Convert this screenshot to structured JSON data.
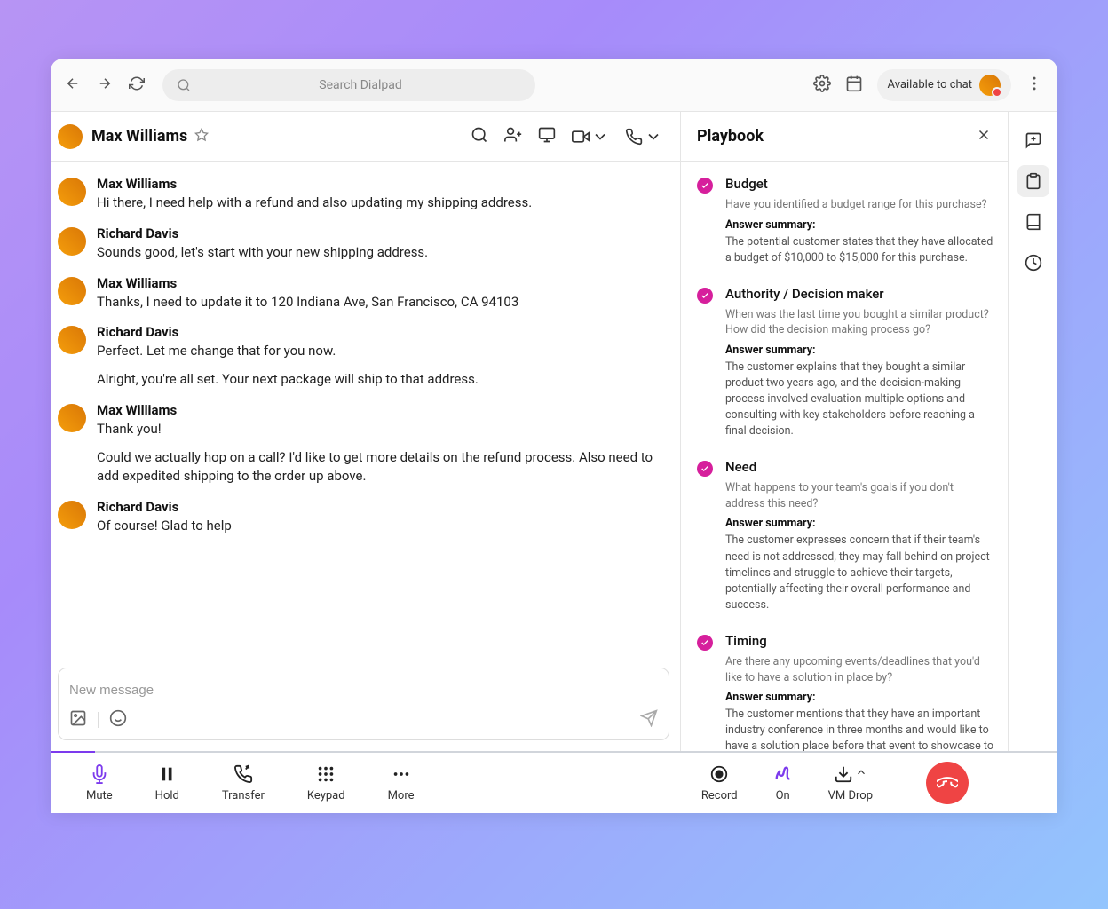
{
  "topbar": {
    "search_placeholder": "Search Dialpad",
    "status_text": "Available to chat"
  },
  "chat": {
    "contact_name": "Max Williams",
    "composer_placeholder": "New message",
    "messages": [
      {
        "name": "Max Williams",
        "texts": [
          "Hi there, I need help with a refund and also updating my shipping address."
        ]
      },
      {
        "name": "Richard Davis",
        "texts": [
          "Sounds good, let's start with your new shipping address."
        ]
      },
      {
        "name": "Max Williams",
        "texts": [
          "Thanks, I need to update it to 120 Indiana Ave, San Francisco, CA 94103"
        ]
      },
      {
        "name": "Richard Davis",
        "texts": [
          "Perfect. Let me change that for you now.",
          "Alright, you're all set. Your next package will ship to that address."
        ]
      },
      {
        "name": "Max Williams",
        "texts": [
          "Thank you!",
          "Could we actually hop on a call? I'd like to get more details on the refund process. Also need to add expedited shipping to the order up above."
        ]
      },
      {
        "name": "Richard Davis",
        "texts": [
          "Of course! Glad to help"
        ]
      }
    ]
  },
  "playbook": {
    "title": "Playbook",
    "answer_summary_label": "Answer summary:",
    "items": [
      {
        "title": "Budget",
        "question": "Have you identified a budget range for this purchase?",
        "summary": "The potential customer states that they have allocated a budget of $10,000 to $15,000 for this purchase."
      },
      {
        "title": "Authority / Decision maker",
        "question": "When was the last time you bought a similar product? How did the decision making process go?",
        "summary": "The customer explains that they bought a similar product two years ago, and the decision-making process involved evaluation multiple options and consulting with key stakeholders before reaching a final decision."
      },
      {
        "title": "Need",
        "question": "What happens to your team's goals if you don't address this need?",
        "summary": "The customer expresses concern that if their team's need is not addressed, they may fall behind on project timelines and struggle to achieve their targets, potentially affecting their overall performance and success."
      },
      {
        "title": "Timing",
        "question": "Are there any upcoming events/deadlines that you'd like to have a solution in place by?",
        "summary": "The customer mentions that they have an important industry conference in three months and would like to have a solution place before that event to showcase to potential clients."
      }
    ]
  },
  "callbar": {
    "mute": "Mute",
    "hold": "Hold",
    "transfer": "Transfer",
    "keypad": "Keypad",
    "more": "More",
    "record": "Record",
    "on": "On",
    "vmdrop": "VM Drop"
  }
}
